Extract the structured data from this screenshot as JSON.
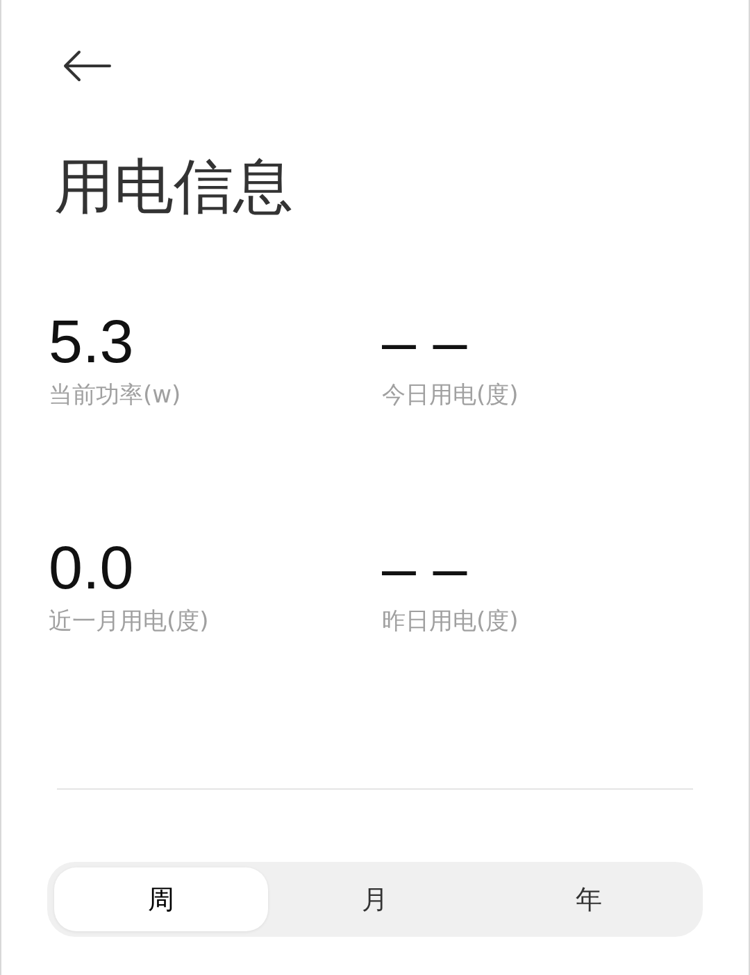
{
  "header": {
    "title": "用电信息"
  },
  "stats": [
    {
      "value": "5.3",
      "label": "当前功率(w)"
    },
    {
      "value": "– –",
      "label": "今日用电(度)"
    },
    {
      "value": "0.0",
      "label": "近一月用电(度)"
    },
    {
      "value": "– –",
      "label": "昨日用电(度)"
    }
  ],
  "period_tabs": [
    {
      "label": "周",
      "selected": true
    },
    {
      "label": "月",
      "selected": false
    },
    {
      "label": "年",
      "selected": false
    }
  ]
}
